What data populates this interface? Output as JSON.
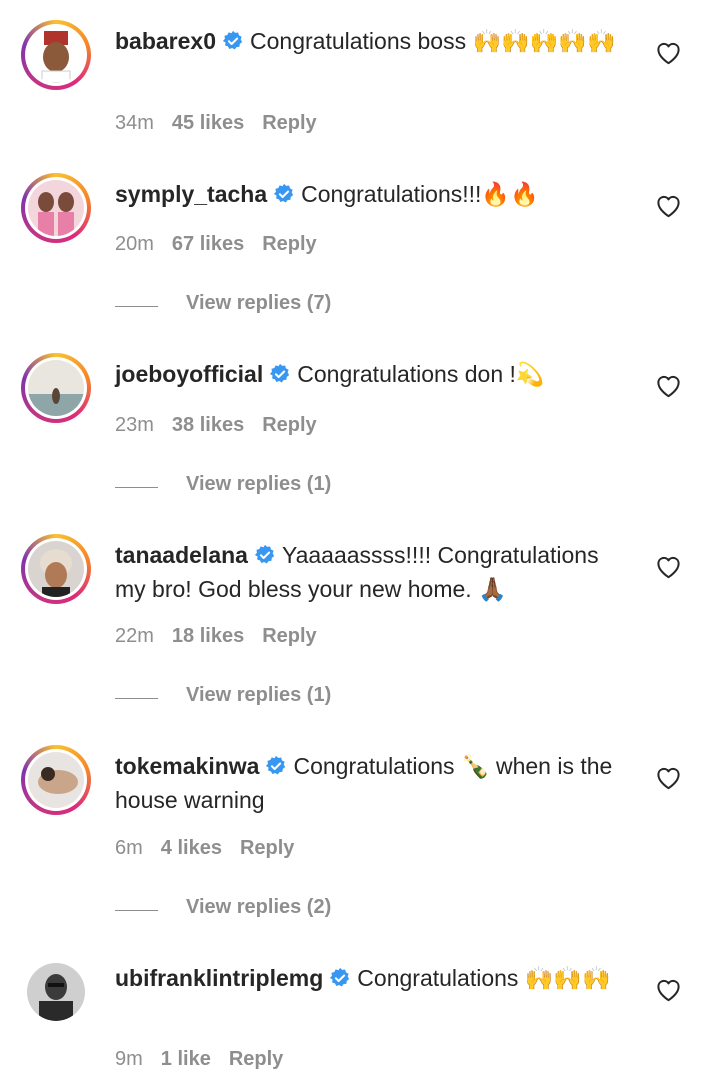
{
  "comments": [
    {
      "username": "babarex0",
      "text": "Congratulations boss 🙌🙌🙌🙌🙌",
      "time": "34m",
      "likes": "45 likes",
      "reply": "Reply",
      "view_replies": ""
    },
    {
      "username": "symply_tacha",
      "text": "Congratulations!!!🔥🔥",
      "time": "20m",
      "likes": "67 likes",
      "reply": "Reply",
      "view_replies": "View replies (7)"
    },
    {
      "username": "joeboyofficial",
      "text": "Congratulations don !💫",
      "time": "23m",
      "likes": "38 likes",
      "reply": "Reply",
      "view_replies": "View replies (1)"
    },
    {
      "username": "tanaadelana",
      "text": "Yaaaaassss!!!! Congratulations my bro! God bless your new home. 🙏🏾",
      "time": "22m",
      "likes": "18 likes",
      "reply": "Reply",
      "view_replies": "View replies (1)"
    },
    {
      "username": "tokemakinwa",
      "text": "Congratulations 🍾 when is the house warning",
      "time": "6m",
      "likes": "4 likes",
      "reply": "Reply",
      "view_replies": "View replies (2)"
    },
    {
      "username": "ubifranklintriplemg",
      "text": "Congratulations 🙌🙌🙌",
      "time": "9m",
      "likes": "1 like",
      "reply": "Reply",
      "view_replies": ""
    }
  ],
  "icons": {
    "verified": "verified-badge-icon",
    "like": "heart-outline-icon"
  },
  "colors": {
    "verified": "#3897f0",
    "meta": "#8e8e8e",
    "text": "#262626"
  }
}
